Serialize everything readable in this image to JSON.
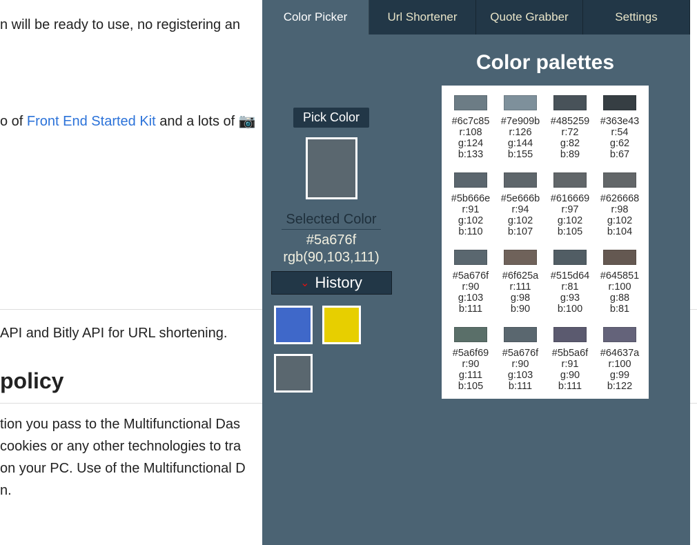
{
  "bg": {
    "line1": "n will be ready to use, no registering an",
    "line2_pre": "o of ",
    "line2_link": "Front End Started Kit",
    "line2_post": " and a lots of ",
    "line3": "API and Bitly API for URL shortening.",
    "heading": "policy",
    "para4a": "tion you pass to the Multifunctional Das",
    "para4b": "cookies or any other technologies to tra",
    "para4c": "on your PC. Use of the Multifunctional D",
    "para4d": "n."
  },
  "tabs": [
    "Color Picker",
    "Url Shortener",
    "Quote Grabber",
    "Settings"
  ],
  "activeTab": 0,
  "pickBtn": "Pick Color",
  "pickedColor": "#5a676f",
  "selectedLabel": "Selected Color",
  "selectedHex": "#5a676f",
  "selectedRgb": "rgb(90,103,111)",
  "historyLabel": "History",
  "historySwatches": [
    "#3f68c9",
    "#e7cf00",
    "#5a676f"
  ],
  "palettesTitle": "Color palettes",
  "palettes": [
    {
      "hex": "#6c7c85",
      "r": 108,
      "g": 124,
      "b": 133
    },
    {
      "hex": "#7e909b",
      "r": 126,
      "g": 144,
      "b": 155
    },
    {
      "hex": "#485259",
      "r": 72,
      "g": 82,
      "b": 89
    },
    {
      "hex": "#363e43",
      "r": 54,
      "g": 62,
      "b": 67
    },
    {
      "hex": "#5b666e",
      "r": 91,
      "g": 102,
      "b": 110
    },
    {
      "hex": "#5e666b",
      "r": 94,
      "g": 102,
      "b": 107
    },
    {
      "hex": "#616669",
      "r": 97,
      "g": 102,
      "b": 105
    },
    {
      "hex": "#626668",
      "r": 98,
      "g": 102,
      "b": 104
    },
    {
      "hex": "#5a676f",
      "r": 90,
      "g": 103,
      "b": 111
    },
    {
      "hex": "#6f625a",
      "r": 111,
      "g": 98,
      "b": 90
    },
    {
      "hex": "#515d64",
      "r": 81,
      "g": 93,
      "b": 100
    },
    {
      "hex": "#645851",
      "r": 100,
      "g": 88,
      "b": 81
    },
    {
      "hex": "#5a6f69",
      "r": 90,
      "g": 111,
      "b": 105
    },
    {
      "hex": "#5a676f",
      "r": 90,
      "g": 103,
      "b": 111
    },
    {
      "hex": "#5b5a6f",
      "r": 91,
      "g": 90,
      "b": 111
    },
    {
      "hex": "#64637a",
      "r": 100,
      "g": 99,
      "b": 122
    }
  ]
}
